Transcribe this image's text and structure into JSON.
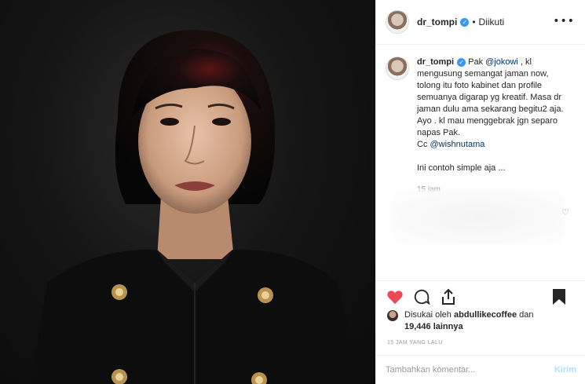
{
  "post": {
    "username": "dr_tompi",
    "follow_status": "Diikuti",
    "separator": "•"
  },
  "caption": {
    "username": "dr_tompi",
    "lines": [
      {
        "before": " Pak ",
        "mention": "@jokowi",
        "after": " , kl"
      },
      "mengusung semangat jaman now,",
      "tolong itu foto kabinet dan profile",
      "semuanya digarap yg kreatif. Masa dr",
      "jaman dulu ama sekarang begitu2 aja.",
      "Ayo . kl mau menggebrak jgn separo",
      "napas Pak."
    ],
    "cc_prefix": "Cc ",
    "cc_mention": "@wishnutama",
    "extra": "Ini contoh simple aja ...",
    "time": "15 jam"
  },
  "likes": {
    "prefix": "Disukai oleh ",
    "user": "abdullikecoffee",
    "and": " dan",
    "count": "19,446 lainnya"
  },
  "timestamp": "15 JAM YANG LALU",
  "comment_box": {
    "placeholder": "Tambahkan komentar...",
    "send_label": "Kirim"
  },
  "icons": {
    "like": "heart-icon",
    "comment": "comment-icon",
    "share": "share-icon",
    "save": "bookmark-icon",
    "more": "more-icon",
    "verified": "verified-badge-icon"
  },
  "colors": {
    "heart": "#ed4956",
    "mention": "#003569",
    "verified": "#3897f0",
    "send_disabled": "#b2dffc"
  }
}
